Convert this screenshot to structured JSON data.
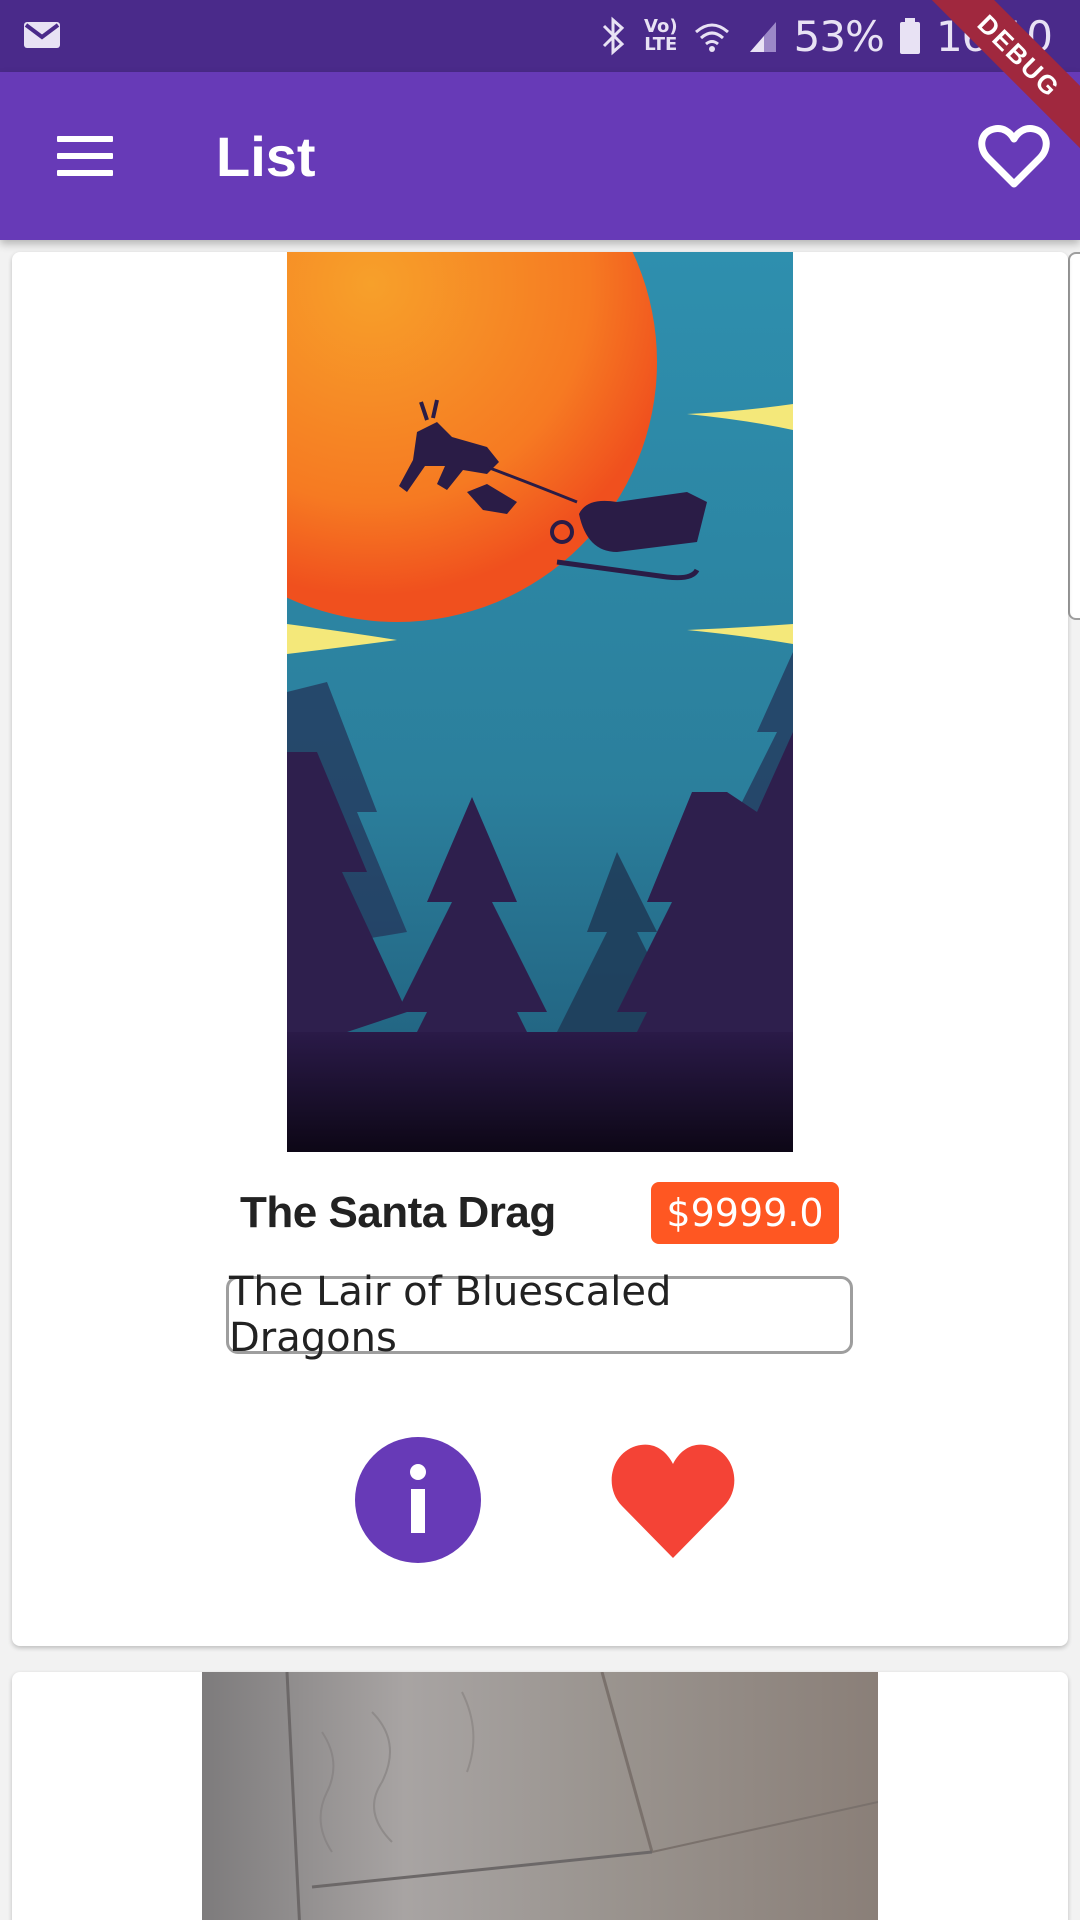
{
  "status_bar": {
    "network": "LTE",
    "battery": "53%",
    "time": "16:10"
  },
  "app_bar": {
    "title": "List"
  },
  "debug_banner": "DEBUG",
  "items": [
    {
      "title": "The Santa Drag",
      "price": "$9999.0",
      "location": "The Lair of Bluescaled Dragons"
    }
  ],
  "colors": {
    "primary": "#673ab7",
    "status_bar": "#4a2a8a",
    "price_badge": "#ff5722",
    "heart": "#f44336"
  }
}
